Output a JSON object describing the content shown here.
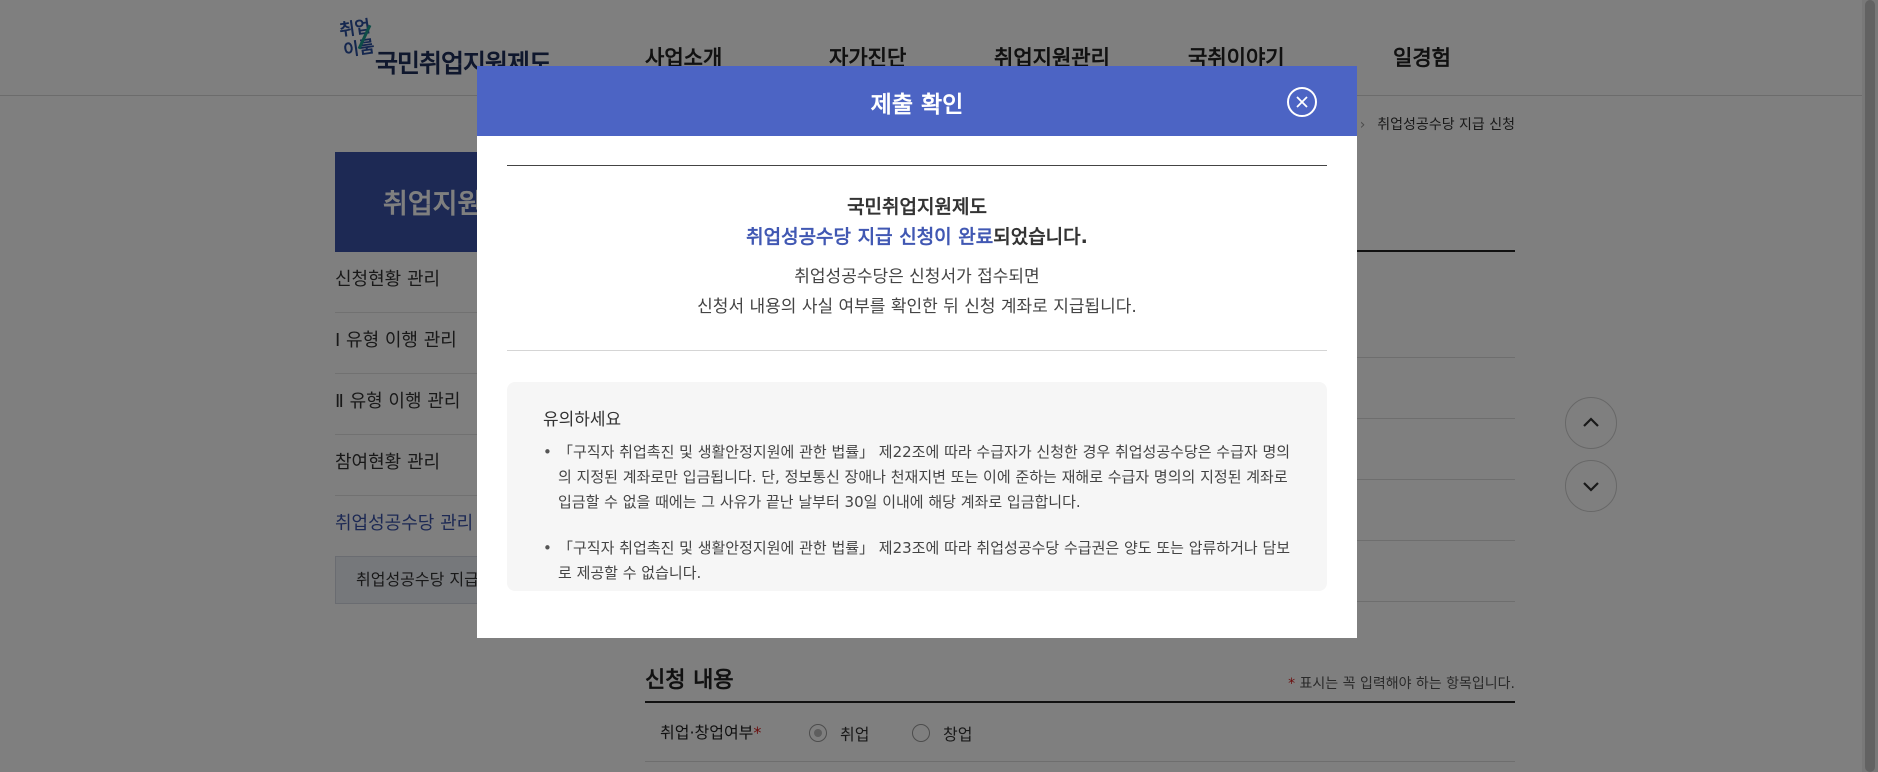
{
  "header": {
    "logo_mark_top": "취업",
    "logo_mark_bottom": "이룸",
    "logo_text": "국민취업지원제도",
    "nav": [
      "사업소개",
      "자가진단",
      "취업지원관리",
      "국취이야기",
      "일경험"
    ]
  },
  "breadcrumb": {
    "current": "취업성공수당 지급 신청"
  },
  "lnb": {
    "title": "취업지원",
    "items": [
      "신청현황 관리",
      "Ⅰ 유형 이행 관리",
      "Ⅱ 유형 이행 관리",
      "참여현황 관리",
      "취업성공수당 관리"
    ],
    "sub_item": "취업성공수당 지급 신"
  },
  "form": {
    "section_title": "신청 내용",
    "required_mark": "*",
    "required_note": "표시는 꼭 입력해야 하는 항목입니다.",
    "field_label": "취업·창업여부",
    "radio_options": [
      "취업",
      "창업"
    ],
    "selected_option": "취업"
  },
  "modal": {
    "title": "제출 확인",
    "line1": "국민취업지원제도",
    "line2_highlight": "취업성공수당 지급 신청이 완료",
    "line2_rest": "되었습니다.",
    "desc1": "취업성공수당은 신청서가 접수되면",
    "desc2": "신청서 내용의 사실 여부를 확인한 뒤 신청 계좌로 지급됩니다.",
    "notice_title": "유의하세요",
    "notice_items": [
      "「구직자 취업촉진 및 생활안정지원에 관한 법률」 제22조에 따라 수급자가 신청한 경우 취업성공수당은 수급자 명의의 지정된 계좌로만 입금됩니다. 단, 정보통신 장애나 천재지변 또는 이에 준하는 재해로 수급자 명의의 지정된 계좌로 입금할 수 없을 때에는 그 사유가 끝난 날부터 30일 이내에 해당 계좌로 입금합니다.",
      "「구직자 취업촉진 및 생활안정지원에 관한 법률」 제23조에 따라 취업성공수당 수급권은 양도 또는 압류하거나 담보로 제공할 수 없습니다."
    ]
  },
  "colors": {
    "modal_header": "#4c64c4",
    "highlight": "#4158b3",
    "lnb_title_bg": "#3a53a8"
  },
  "icons": {
    "close": "close-circle-icon",
    "scroll_up": "chevron-up-icon",
    "scroll_down": "chevron-down-icon"
  }
}
